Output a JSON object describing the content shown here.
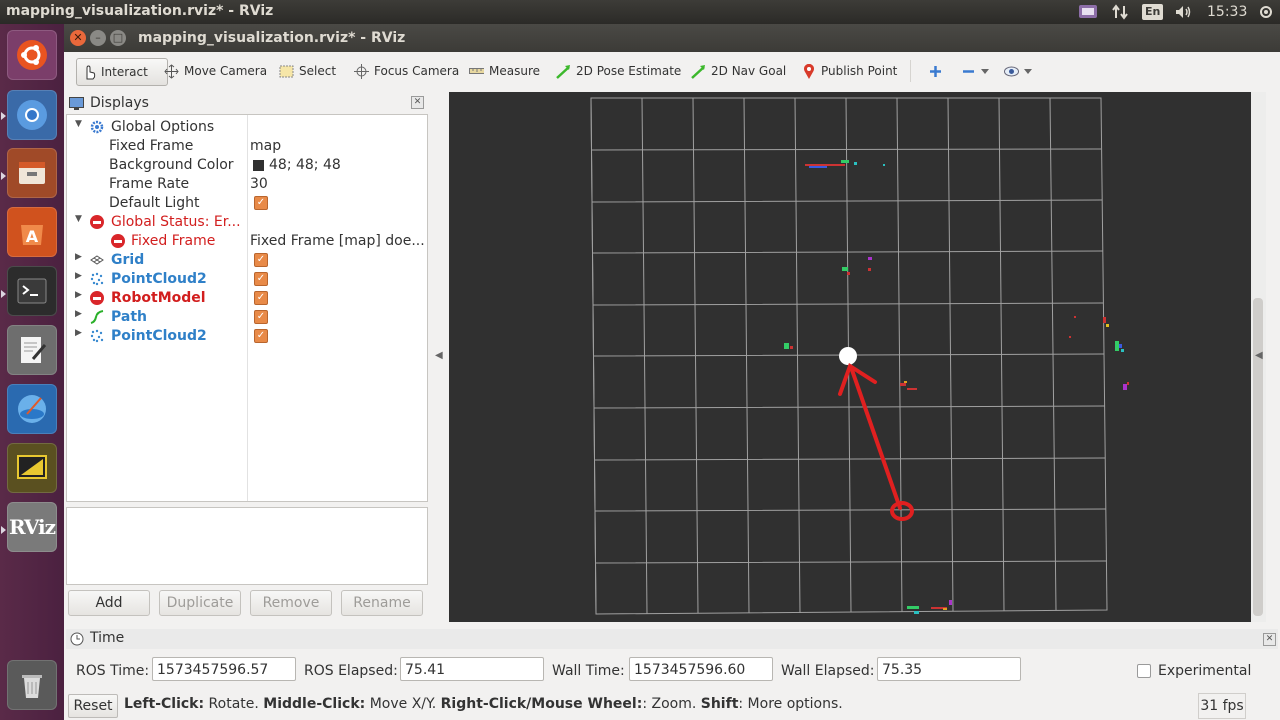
{
  "top_panel": {
    "title": "mapping_visualization.rviz* - RViz",
    "keyboard": "En",
    "clock": "15:33"
  },
  "launcher": {
    "items": [
      "ubuntu-logo-icon",
      "chromium-icon",
      "files-icon",
      "software-center-icon",
      "terminal-icon",
      "text-editor-icon",
      "browser-icon",
      "drawing-icon",
      "rviz-icon",
      "trash-icon"
    ],
    "rviz_label": "RViz"
  },
  "window": {
    "title": "mapping_visualization.rviz* - RViz"
  },
  "toolbar": {
    "interact": "Interact",
    "move_camera": "Move Camera",
    "select": "Select",
    "focus_camera": "Focus Camera",
    "measure": "Measure",
    "pose_estimate": "2D Pose Estimate",
    "nav_goal": "2D Nav Goal",
    "publish_point": "Publish Point"
  },
  "displays": {
    "title": "Displays",
    "global_options": "Global Options",
    "fixed_frame_label": "Fixed Frame",
    "fixed_frame_value": "map",
    "bg_color_label": "Background Color",
    "bg_color_value": "48; 48; 48",
    "frame_rate_label": "Frame Rate",
    "frame_rate_value": "30",
    "default_light_label": "Default Light",
    "global_status": "Global Status: Er...",
    "status_fixed_frame": "Fixed Frame",
    "status_fixed_frame_value": "Fixed Frame [map] doe...",
    "grid": "Grid",
    "pointcloud_1": "PointCloud2",
    "robot_model": "RobotModel",
    "path": "Path",
    "pointcloud_2": "PointCloud2"
  },
  "panel_buttons": {
    "add": "Add",
    "duplicate": "Duplicate",
    "remove": "Remove",
    "rename": "Rename"
  },
  "time": {
    "title": "Time",
    "ros_time_label": "ROS Time:",
    "ros_time_value": "1573457596.57",
    "ros_elapsed_label": "ROS Elapsed:",
    "ros_elapsed_value": "75.41",
    "wall_time_label": "Wall Time:",
    "wall_time_value": "1573457596.60",
    "wall_elapsed_label": "Wall Elapsed:",
    "wall_elapsed_value": "75.35",
    "experimental_label": "Experimental"
  },
  "status": {
    "reset": "Reset",
    "left_click": "Left-Click:",
    "left_click_desc": " Rotate. ",
    "middle_click": "Middle-Click:",
    "middle_click_desc": " Move X/Y. ",
    "right_click": "Right-Click/Mouse Wheel:",
    "right_click_desc": ": Zoom. ",
    "shift": "Shift",
    "shift_desc": ": More options.",
    "fps": "31 fps"
  },
  "colors": {
    "view_background": "#303030",
    "grid_line": "#a0a0a0",
    "annotation_red": "#e02020",
    "error_red": "#d21e1e",
    "link_blue": "#2f80c8",
    "checkbox_orange": "#e88a48"
  }
}
